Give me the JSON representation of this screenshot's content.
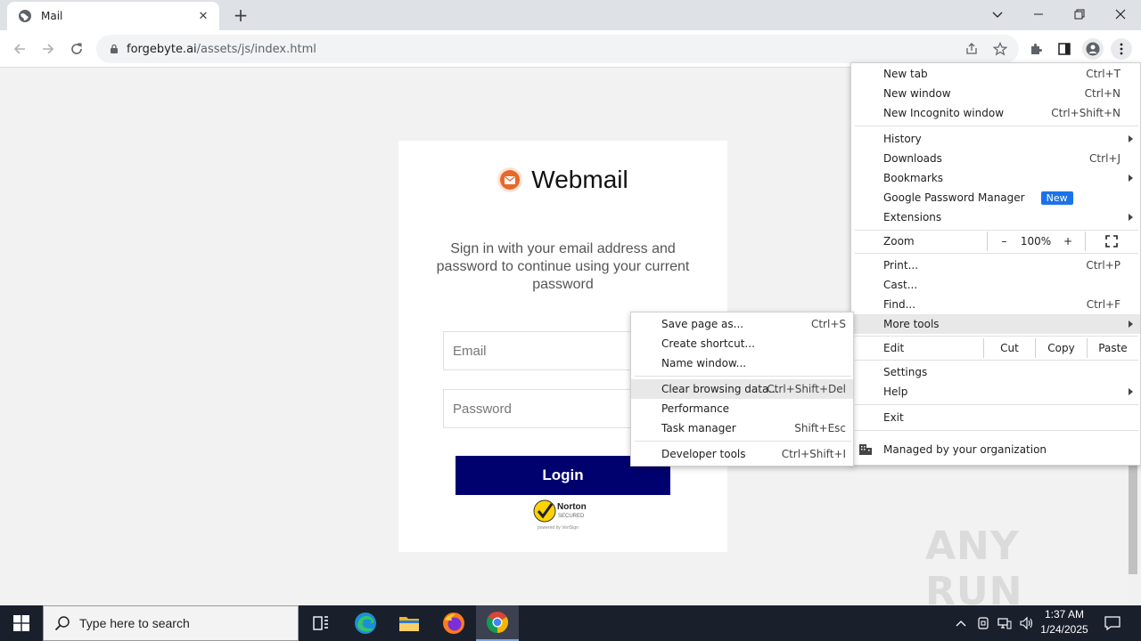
{
  "browser": {
    "tab_title": "Mail",
    "url_host": "forgebyte.ai",
    "url_path": "/assets/js/index.html"
  },
  "page": {
    "brand_name": "Webmail",
    "subtitle": "Sign in with your email address and password to continue using your current password",
    "email_placeholder": "Email",
    "password_placeholder": "Password",
    "login_label": "Login",
    "norton_brand": "Norton",
    "norton_secured": "SECURED",
    "norton_powered": "powered by VeriSign",
    "watermark": "ANY RUN"
  },
  "menu": {
    "new_tab": "New tab",
    "new_tab_sc": "Ctrl+T",
    "new_window": "New window",
    "new_window_sc": "Ctrl+N",
    "new_incognito": "New Incognito window",
    "new_incognito_sc": "Ctrl+Shift+N",
    "history": "History",
    "downloads": "Downloads",
    "downloads_sc": "Ctrl+J",
    "bookmarks": "Bookmarks",
    "password_manager": "Google Password Manager",
    "new_badge": "New",
    "extensions": "Extensions",
    "zoom": "Zoom",
    "zoom_minus": "–",
    "zoom_value": "100%",
    "zoom_plus": "+",
    "print": "Print...",
    "print_sc": "Ctrl+P",
    "cast": "Cast...",
    "find": "Find...",
    "find_sc": "Ctrl+F",
    "more_tools": "More tools",
    "edit": "Edit",
    "cut": "Cut",
    "copy": "Copy",
    "paste": "Paste",
    "settings": "Settings",
    "help": "Help",
    "exit": "Exit",
    "managed": "Managed by your organization"
  },
  "submenu": {
    "save_page": "Save page as...",
    "save_page_sc": "Ctrl+S",
    "create_shortcut": "Create shortcut...",
    "name_window": "Name window...",
    "clear_data": "Clear browsing data...",
    "clear_data_sc": "Ctrl+Shift+Del",
    "performance": "Performance",
    "task_manager": "Task manager",
    "task_manager_sc": "Shift+Esc",
    "developer_tools": "Developer tools",
    "developer_tools_sc": "Ctrl+Shift+I"
  },
  "taskbar": {
    "search_placeholder": "Type here to search",
    "time": "1:37 AM",
    "date": "1/24/2025"
  },
  "colors": {
    "login_button": "#00006e",
    "new_badge": "#1a73e8",
    "taskbar": "#1a1f2c"
  }
}
